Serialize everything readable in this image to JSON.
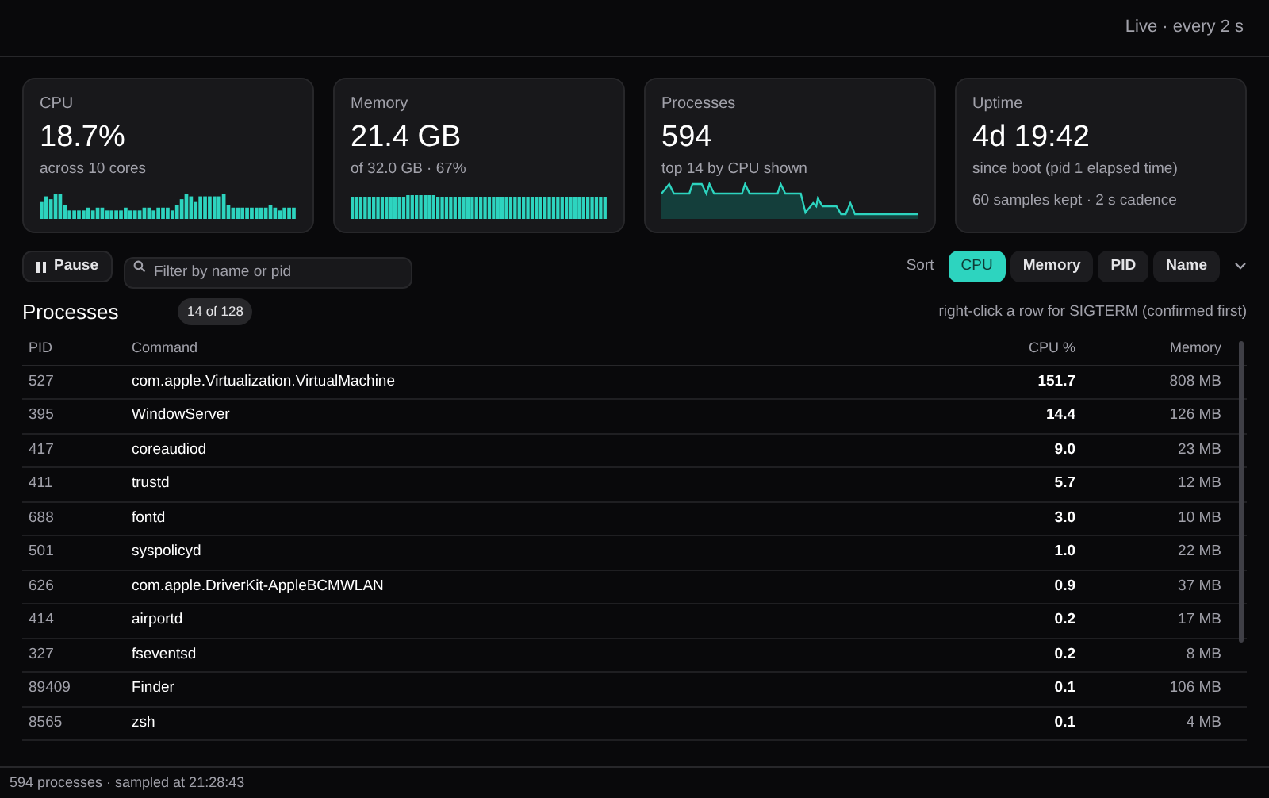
{
  "header": {
    "status": "Live · every 2 s"
  },
  "cards": [
    {
      "kind": "bars",
      "label": "CPU",
      "value": "18.7%",
      "sub": "across 10 cores"
    },
    {
      "kind": "fullbars",
      "label": "Memory",
      "value": "21.4 GB",
      "sub": "of 32.0 GB · 67%"
    },
    {
      "kind": "line",
      "label": "Processes",
      "value": "594",
      "sub": "top 14 by CPU shown"
    },
    {
      "kind": "text",
      "label": "Uptime",
      "value": "4d 19:42",
      "sub": "since boot (pid 1 elapsed time)",
      "note": "60 samples kept · 2 s cadence"
    }
  ],
  "toolbar": {
    "pause": "Pause",
    "search": {
      "placeholder": "Filter by name or pid"
    },
    "sort_label": "Sort",
    "sort_options": [
      {
        "label": "CPU",
        "selected": true
      },
      {
        "label": "Memory",
        "selected": false
      },
      {
        "label": "PID",
        "selected": false
      },
      {
        "label": "Name",
        "selected": false
      }
    ]
  },
  "processes": {
    "title": "Processes",
    "count": "14 of 128",
    "hint": "right-click a row for SIGTERM (confirmed first)",
    "columns": [
      "PID",
      "Command",
      "CPU %",
      "Memory"
    ],
    "rows": [
      {
        "pid": "527",
        "command": "com.apple.Virtualization.VirtualMachine",
        "cpu": "151.7",
        "memory": "808 MB"
      },
      {
        "pid": "395",
        "command": "WindowServer",
        "cpu": "14.4",
        "memory": "126 MB"
      },
      {
        "pid": "417",
        "command": "coreaudiod",
        "cpu": "9.0",
        "memory": "23 MB"
      },
      {
        "pid": "411",
        "command": "trustd",
        "cpu": "5.7",
        "memory": "12 MB"
      },
      {
        "pid": "688",
        "command": "fontd",
        "cpu": "3.0",
        "memory": "10 MB"
      },
      {
        "pid": "501",
        "command": "syspolicyd",
        "cpu": "1.0",
        "memory": "22 MB"
      },
      {
        "pid": "626",
        "command": "com.apple.DriverKit-AppleBCMWLAN",
        "cpu": "0.9",
        "memory": "37 MB"
      },
      {
        "pid": "414",
        "command": "airportd",
        "cpu": "0.2",
        "memory": "17 MB"
      },
      {
        "pid": "327",
        "command": "fseventsd",
        "cpu": "0.2",
        "memory": "8 MB"
      },
      {
        "pid": "89409",
        "command": "Finder",
        "cpu": "0.1",
        "memory": "106 MB"
      },
      {
        "pid": "8565",
        "command": "zsh",
        "cpu": "0.1",
        "memory": "4 MB"
      }
    ]
  },
  "status_bar": "594 processes · sampled at 21:28:43"
}
